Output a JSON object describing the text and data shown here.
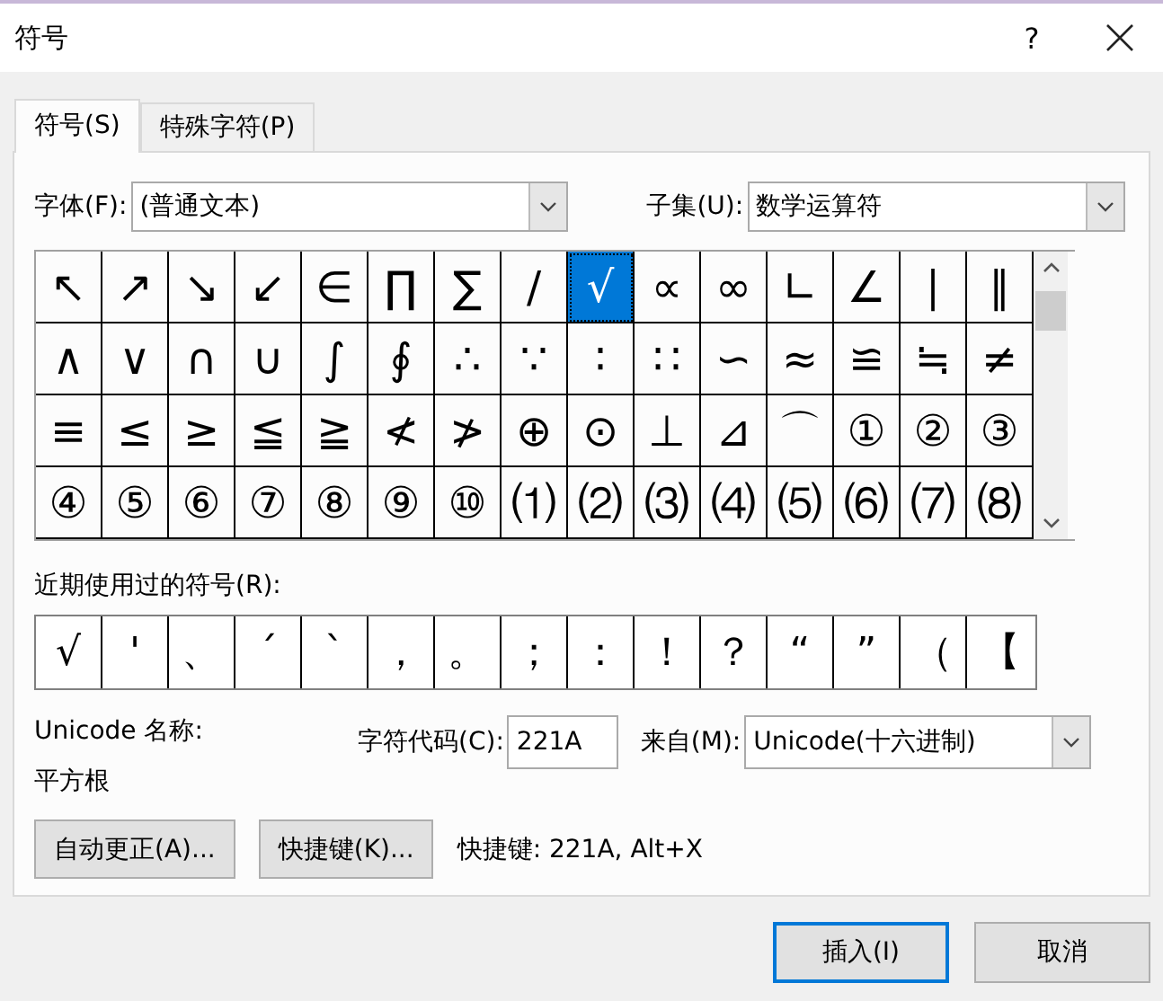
{
  "window": {
    "title": "符号",
    "help": "?"
  },
  "tabs": [
    {
      "label": "符号(S)",
      "selected": true
    },
    {
      "label": "特殊字符(P)",
      "selected": false
    }
  ],
  "font": {
    "label": "字体(F):",
    "value": "(普通文本)"
  },
  "subset": {
    "label": "子集(U):",
    "value": "数学运算符"
  },
  "symbols": [
    {
      "char": "↖",
      "selected": false
    },
    {
      "char": "↗",
      "selected": false
    },
    {
      "char": "↘",
      "selected": false
    },
    {
      "char": "↙",
      "selected": false
    },
    {
      "char": "∈",
      "selected": false
    },
    {
      "char": "∏",
      "selected": false
    },
    {
      "char": "∑",
      "selected": false
    },
    {
      "char": "∕",
      "selected": false
    },
    {
      "char": "√",
      "selected": true
    },
    {
      "char": "∝",
      "selected": false
    },
    {
      "char": "∞",
      "selected": false
    },
    {
      "char": "∟",
      "selected": false
    },
    {
      "char": "∠",
      "selected": false
    },
    {
      "char": "∣",
      "selected": false
    },
    {
      "char": "∥",
      "selected": false
    },
    {
      "char": "∧",
      "selected": false
    },
    {
      "char": "∨",
      "selected": false
    },
    {
      "char": "∩",
      "selected": false
    },
    {
      "char": "∪",
      "selected": false
    },
    {
      "char": "∫",
      "selected": false
    },
    {
      "char": "∮",
      "selected": false
    },
    {
      "char": "∴",
      "selected": false
    },
    {
      "char": "∵",
      "selected": false
    },
    {
      "char": "∶",
      "selected": false
    },
    {
      "char": "∷",
      "selected": false
    },
    {
      "char": "∽",
      "selected": false
    },
    {
      "char": "≈",
      "selected": false
    },
    {
      "char": "≌",
      "selected": false
    },
    {
      "char": "≒",
      "selected": false
    },
    {
      "char": "≠",
      "selected": false
    },
    {
      "char": "≡",
      "selected": false
    },
    {
      "char": "≤",
      "selected": false
    },
    {
      "char": "≥",
      "selected": false
    },
    {
      "char": "≦",
      "selected": false
    },
    {
      "char": "≧",
      "selected": false
    },
    {
      "char": "≮",
      "selected": false
    },
    {
      "char": "≯",
      "selected": false
    },
    {
      "char": "⊕",
      "selected": false
    },
    {
      "char": "⊙",
      "selected": false
    },
    {
      "char": "⊥",
      "selected": false
    },
    {
      "char": "⊿",
      "selected": false
    },
    {
      "char": "⌒",
      "selected": false
    },
    {
      "char": "①",
      "selected": false
    },
    {
      "char": "②",
      "selected": false
    },
    {
      "char": "③",
      "selected": false
    },
    {
      "char": "④",
      "selected": false
    },
    {
      "char": "⑤",
      "selected": false
    },
    {
      "char": "⑥",
      "selected": false
    },
    {
      "char": "⑦",
      "selected": false
    },
    {
      "char": "⑧",
      "selected": false
    },
    {
      "char": "⑨",
      "selected": false
    },
    {
      "char": "⑩",
      "selected": false
    },
    {
      "char": "⑴",
      "selected": false
    },
    {
      "char": "⑵",
      "selected": false
    },
    {
      "char": "⑶",
      "selected": false
    },
    {
      "char": "⑷",
      "selected": false
    },
    {
      "char": "⑸",
      "selected": false
    },
    {
      "char": "⑹",
      "selected": false
    },
    {
      "char": "⑺",
      "selected": false
    },
    {
      "char": "⑻",
      "selected": false
    }
  ],
  "recent": {
    "label": "近期使用过的符号(R):",
    "symbols": [
      "√",
      "'",
      "、",
      "ˊ",
      "ˋ",
      "，",
      "。",
      "；",
      "：",
      "！",
      "？",
      "“",
      "”",
      "（",
      "【"
    ]
  },
  "unicode_name": {
    "label": "Unicode 名称:",
    "value": "平方根"
  },
  "char_code": {
    "label": "字符代码(C):",
    "value": "221A"
  },
  "from": {
    "label": "来自(M):",
    "value": "Unicode(十六进制)"
  },
  "action_buttons": [
    "自动更正(A)...",
    "快捷键(K)..."
  ],
  "shortcut_text": "快捷键: 221A, Alt+X",
  "footer_buttons": [
    {
      "label": "插入(I)",
      "default": true
    },
    {
      "label": "取消",
      "default": false
    }
  ]
}
